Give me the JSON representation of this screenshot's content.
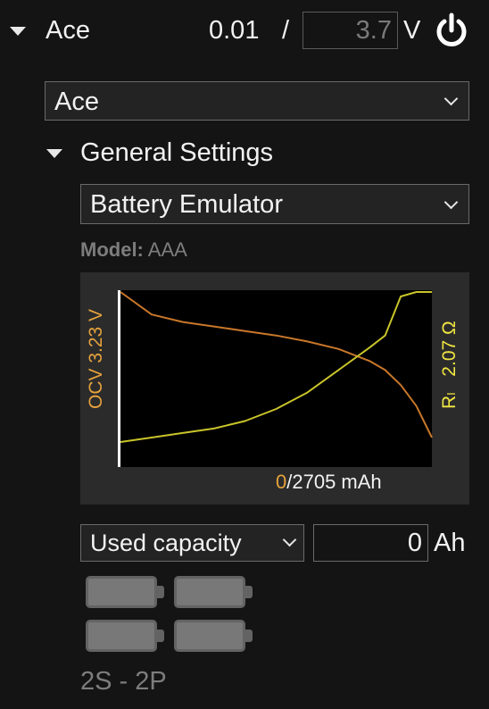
{
  "header": {
    "channel_name": "Ace",
    "voltage_readout": "0.01",
    "separator": "/",
    "voltage_setpoint": "3.7",
    "voltage_unit": "V",
    "power_icon": "power-icon"
  },
  "device_select": {
    "value": "Ace"
  },
  "general": {
    "title": "General Settings",
    "mode_select": "Battery Emulator",
    "model_label": "Model:",
    "model_value": "AAA"
  },
  "chart_data": {
    "type": "line",
    "x": [
      0,
      0.1,
      0.2,
      0.3,
      0.4,
      0.5,
      0.6,
      0.7,
      0.8,
      0.85,
      0.9,
      0.95,
      1.0
    ],
    "series": [
      {
        "name": "OCV",
        "color": "#c8772a",
        "values": [
          1.0,
          0.85,
          0.8,
          0.77,
          0.74,
          0.71,
          0.67,
          0.62,
          0.54,
          0.48,
          0.38,
          0.24,
          0.03
        ]
      },
      {
        "name": "Ri",
        "color": "#c9c42a",
        "values": [
          0.0,
          0.03,
          0.06,
          0.09,
          0.14,
          0.22,
          0.33,
          0.48,
          0.63,
          0.71,
          0.97,
          1.0,
          1.0
        ]
      }
    ],
    "left_label": "OCV 3.23 V",
    "right_label_main": "2.07 Ω",
    "right_label_prefix": "R",
    "right_label_sub": "I",
    "capacity_used": "0",
    "capacity_total": "/2705 mAh",
    "colors": {
      "ocv": "#e6a23c",
      "ri": "#f0e642",
      "plot_bg": "#000000",
      "panel_bg": "#2b2b2b"
    }
  },
  "capacity": {
    "mode_select": "Used capacity",
    "value": "0",
    "unit": "Ah"
  },
  "pack": {
    "config": "2S - 2P",
    "cells": [
      "battery-cell-icon",
      "battery-cell-icon",
      "battery-cell-icon",
      "battery-cell-icon"
    ]
  }
}
